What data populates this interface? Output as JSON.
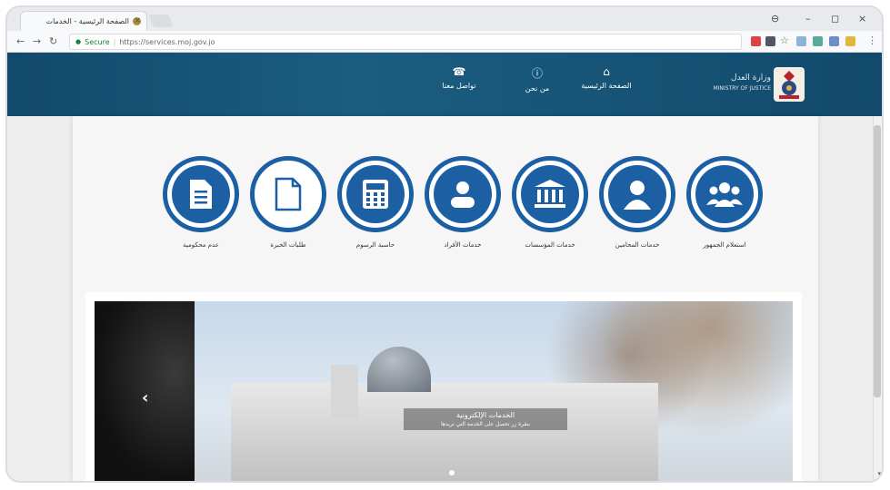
{
  "browser": {
    "tab_title": "الصفحة الرئيسية - الخدمات",
    "tab_close": "×",
    "url_secure": "Secure",
    "url": "https://services.moj.gov.jo",
    "minimize": "–",
    "restore": "◻",
    "close": "×",
    "menu": "⋮"
  },
  "header": {
    "logo_ar": "وزارة العدل",
    "logo_en": "MINISTRY OF JUSTICE",
    "nav": [
      {
        "label": "الصفحة الرئيسية",
        "icon": "home-icon"
      },
      {
        "label": "من نحن",
        "icon": "info-icon"
      },
      {
        "label": "تواصل معنا",
        "icon": "phone-icon"
      }
    ]
  },
  "services": [
    {
      "label": "استعلام الجمهور",
      "icon": "users-group-icon"
    },
    {
      "label": "خدمات المحامين",
      "icon": "person-icon"
    },
    {
      "label": "خدمات المؤسسات",
      "icon": "institution-icon"
    },
    {
      "label": "خدمات الأفراد",
      "icon": "user-icon"
    },
    {
      "label": "حاسبة الرسوم",
      "icon": "calculator-icon"
    },
    {
      "label": "طلبات الخبرة",
      "icon": "document-icon"
    },
    {
      "label": "عدم محكومية",
      "icon": "file-text-icon"
    }
  ],
  "slider": {
    "caption_title": "الخدمات الإلكترونية",
    "caption_sub": "بنقرة زر تحصل على الخدمة التي تريدها",
    "prev": "‹"
  },
  "colors": {
    "header_bg": "#12496c",
    "service_blue": "#1d5fa3"
  }
}
